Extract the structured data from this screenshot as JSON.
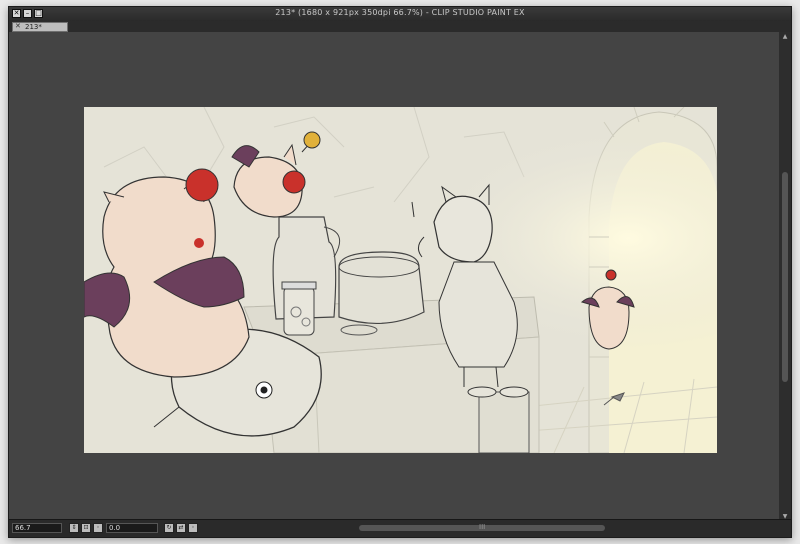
{
  "window": {
    "title": "213* (1680 x 921px 350dpi 66.7%)  - CLIP STUDIO PAINT EX",
    "controls": {
      "close": "✕",
      "minimize": "–",
      "maximize": "□"
    }
  },
  "tab": {
    "close": "✕",
    "label": "213*"
  },
  "status": {
    "zoom": "66.7",
    "angle": "0.0",
    "hmarker": "III"
  },
  "scroll": {
    "up": "▲",
    "down": "▼"
  },
  "colors": {
    "window_bg": "#3c3c3c",
    "canvas_bg": "#e6e4d9",
    "moogle_pink": "#f1dccb",
    "pompom_red": "#c9312b",
    "wing_purple": "#6b3f5c"
  },
  "icons": [
    "close-icon",
    "minimize-icon",
    "maximize-icon",
    "rotate-icon",
    "flip-icon",
    "fit-icon",
    "reset-icon"
  ]
}
